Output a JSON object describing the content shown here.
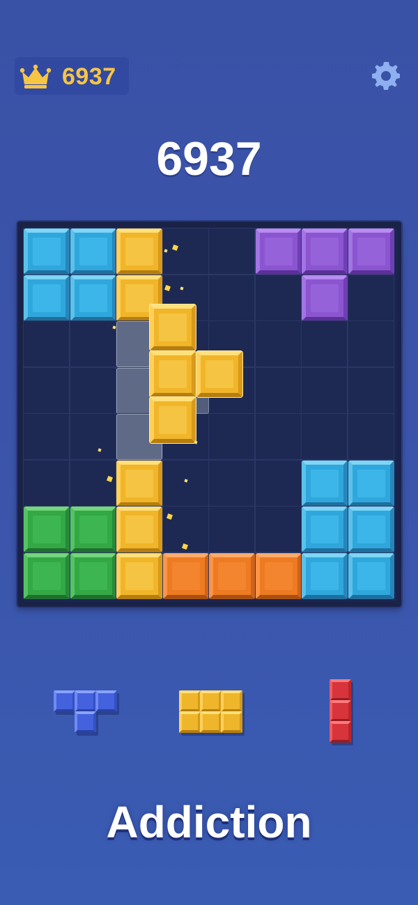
{
  "header": {
    "best_score": "6937",
    "best_icon": "crown-icon",
    "settings_icon": "gear-icon"
  },
  "score": "6937",
  "board": {
    "rows": 8,
    "cols": 8,
    "cells": [
      [
        "cyan",
        "cyan",
        "yellow",
        "",
        "",
        "purple",
        "purple",
        "purple"
      ],
      [
        "cyan",
        "cyan",
        "yellow",
        "",
        "",
        "",
        "purple",
        ""
      ],
      [
        "",
        "",
        "ghost",
        "",
        "",
        "",
        "",
        ""
      ],
      [
        "",
        "",
        "ghost",
        "",
        "",
        "",
        "",
        ""
      ],
      [
        "",
        "",
        "ghost",
        "",
        "",
        "",
        "",
        ""
      ],
      [
        "",
        "",
        "yellow",
        "",
        "",
        "",
        "cyan",
        "cyan"
      ],
      [
        "green",
        "green",
        "yellow",
        "",
        "",
        "",
        "cyan",
        "cyan"
      ],
      [
        "green",
        "green",
        "yellow",
        "orange",
        "orange",
        "orange",
        "cyan",
        "cyan"
      ]
    ],
    "dragging_piece": {
      "color": "yellow",
      "shape": "T",
      "cells": [
        [
          0,
          0
        ],
        [
          1,
          0
        ],
        [
          1,
          1
        ],
        [
          2,
          0
        ]
      ]
    }
  },
  "tray": [
    {
      "name": "blue-t-piece",
      "color": "blue",
      "cells": [
        [
          0,
          0
        ],
        [
          0,
          1
        ],
        [
          0,
          2
        ],
        [
          1,
          1
        ]
      ]
    },
    {
      "name": "yellow-rect-piece",
      "color": "yellow",
      "cells": [
        [
          0,
          0
        ],
        [
          0,
          1
        ],
        [
          0,
          2
        ],
        [
          1,
          0
        ],
        [
          1,
          1
        ],
        [
          1,
          2
        ]
      ]
    },
    {
      "name": "red-i-piece",
      "color": "red",
      "cells": [
        [
          0,
          0
        ],
        [
          1,
          0
        ],
        [
          2,
          0
        ]
      ]
    }
  ],
  "tagline": "Addiction",
  "colors": {
    "background": "#3a52a6",
    "score_text": "#ffffff",
    "best_text": "#f7c544"
  }
}
